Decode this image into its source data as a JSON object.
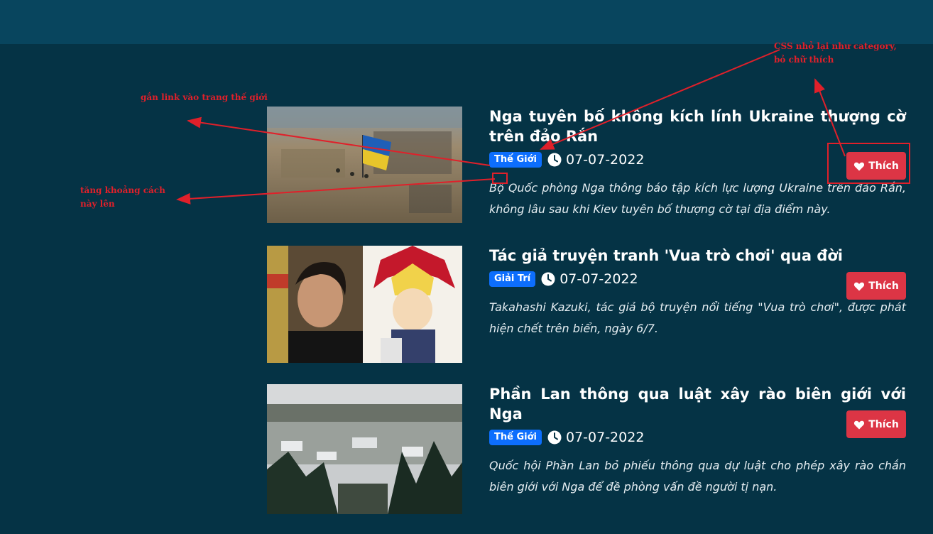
{
  "annotations": {
    "link_note": "gắn link vào trang thế giới",
    "spacing_note_line1": "tăng khoảng cách",
    "spacing_note_line2": "này lên",
    "css_note_line1": "CSS nhỏ lại như category,",
    "css_note_line2": "bỏ chữ thích",
    "color": "#e0202a"
  },
  "articles": [
    {
      "title": "Nga tuyên bố không kích lính Ukraine thượng cờ trên đảo Rắn",
      "category": "Thế Giới",
      "date": "07-07-2022",
      "description": "Bộ Quốc phòng Nga thông báo tập kích lực lượng Ukraine trên đảo Rắn, không lâu sau khi Kiev tuyên bố thượng cờ tại địa điểm này.",
      "like_label": "Thích",
      "like_icon": "heart-icon",
      "date_icon": "clock-icon"
    },
    {
      "title": "Tác giả truyện tranh 'Vua trò chơi' qua đời",
      "category": "Giải Trí",
      "date": "07-07-2022",
      "description": "Takahashi Kazuki, tác giả bộ truyện nổi tiếng \"Vua trò chơi\", được phát hiện chết trên biển, ngày 6/7.",
      "like_label": "Thích",
      "like_icon": "heart-icon",
      "date_icon": "clock-icon"
    },
    {
      "title": "Phần Lan thông qua luật xây rào biên giới với Nga",
      "category": "Thế Giới",
      "date": "07-07-2022",
      "description": "Quốc hội Phần Lan bỏ phiếu thông qua dự luật cho phép xây rào chắn biên giới với Nga để đề phòng vấn đề người tị nạn.",
      "like_label": "Thích",
      "like_icon": "heart-icon",
      "date_icon": "clock-icon"
    }
  ],
  "colors": {
    "background": "#053345",
    "topbar": "#08455e",
    "badge": "#0d6efd",
    "like_button": "#dc3545"
  }
}
